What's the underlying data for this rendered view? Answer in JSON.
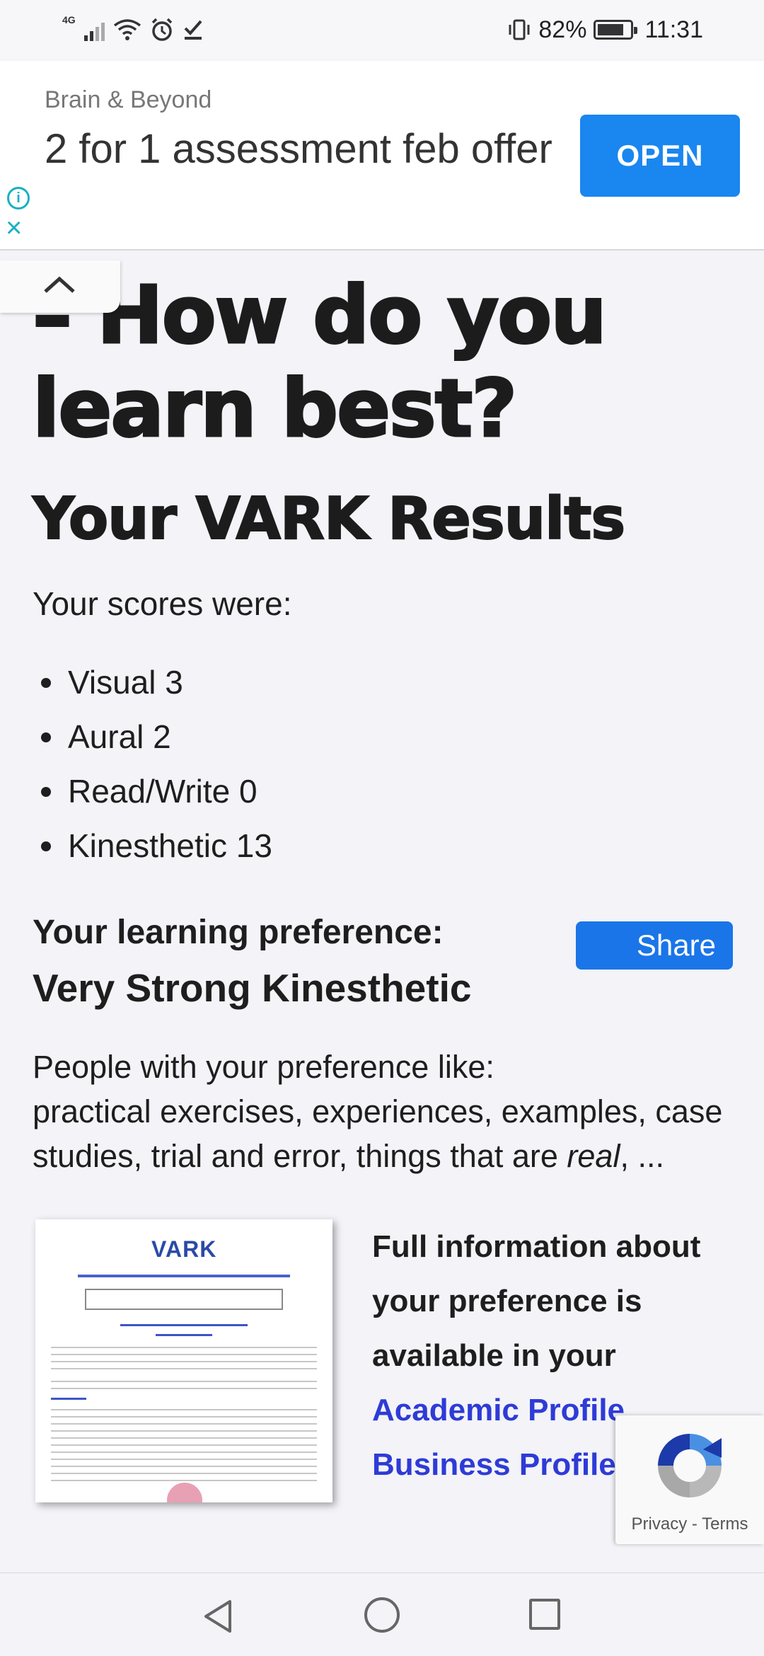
{
  "status_bar": {
    "network": "4G",
    "battery": "82%",
    "battery_level": 0.82,
    "time": "11:31",
    "icons": [
      "signal-icon",
      "wifi-icon",
      "alarm-icon",
      "check-icon",
      "vibrate-icon",
      "battery-icon"
    ]
  },
  "ad": {
    "advertiser": "Brain & Beyond",
    "headline": "2 for 1 assessment feb offer",
    "cta": "OPEN",
    "info_icon": "i",
    "close_icon": "×"
  },
  "page": {
    "title": "– How do you learn best?",
    "subtitle": "Your VARK Results",
    "scores_label": "Your scores were:",
    "scores": [
      "Visual 3",
      "Aural 2",
      "Read/Write 0",
      "Kinesthetic 13"
    ],
    "preference_label": "Your learning preference:",
    "preference_value": "Very Strong Kinesthetic",
    "share_label": "Share",
    "people_intro": "People with your preference like:",
    "people_list": "practical exercises, experiences, examples, case studies, trial and error, things that are",
    "people_real": "real",
    "people_tail": ", ...",
    "full_info": "Full information about your preference is available in your",
    "academic_link": "Academic Profile",
    "business_link": "Business Profile",
    "doc_logo": "VARK"
  },
  "recaptcha": {
    "privacy": "Privacy",
    "sep": " - ",
    "terms": "Terms"
  },
  "colors": {
    "accent": "#1a86f0",
    "share": "#1a75e8",
    "link": "#2e3bd6",
    "ad_icon": "#1ab0c4"
  }
}
